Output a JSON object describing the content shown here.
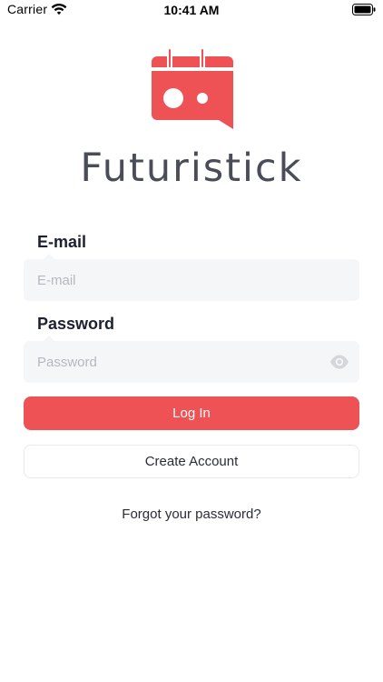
{
  "status_bar": {
    "carrier": "Carrier",
    "time": "10:41 AM",
    "icons": [
      "wifi-icon",
      "battery-icon"
    ]
  },
  "brand": {
    "name": "Futuristick",
    "logo_icon": "calendar-chat-logo",
    "accent_color": "#ee5254",
    "text_color": "#4a4d57"
  },
  "form": {
    "email_label": "E-mail",
    "email_placeholder": "E-mail",
    "email_value": "",
    "password_label": "Password",
    "password_placeholder": "Password",
    "password_value": "",
    "password_toggle_icon": "eye-icon"
  },
  "actions": {
    "login_label": "Log In",
    "create_account_label": "Create Account",
    "forgot_password_label": "Forgot your password?"
  }
}
